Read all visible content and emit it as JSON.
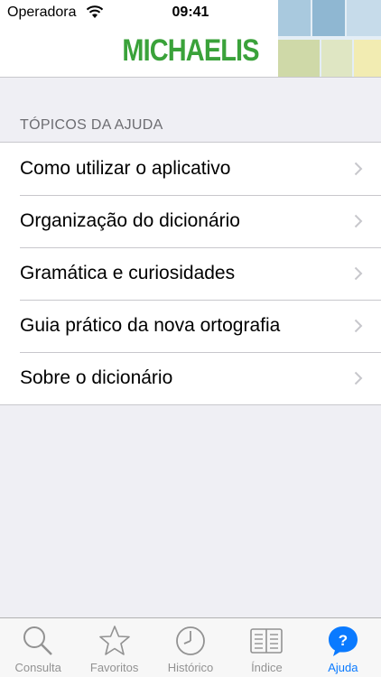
{
  "status": {
    "carrier": "Operadora",
    "time": "09:41"
  },
  "header": {
    "logo_text": "MICHAELIS",
    "brand_color": "#3aa23a"
  },
  "help": {
    "section_title": "TÓPICOS DA AJUDA",
    "items": [
      {
        "label": "Como utilizar o aplicativo"
      },
      {
        "label": "Organização do dicionário"
      },
      {
        "label": "Gramática e curiosidades"
      },
      {
        "label": "Guia prático da nova ortografia"
      },
      {
        "label": "Sobre o dicionário"
      }
    ]
  },
  "tabbar": {
    "active_color": "#0a7aff",
    "tabs": [
      {
        "label": "Consulta",
        "icon": "magnifier-icon"
      },
      {
        "label": "Favoritos",
        "icon": "star-icon"
      },
      {
        "label": "Histórico",
        "icon": "clock-icon"
      },
      {
        "label": "Índice",
        "icon": "book-icon"
      },
      {
        "label": "Ajuda",
        "icon": "help-icon",
        "active": true
      }
    ]
  }
}
